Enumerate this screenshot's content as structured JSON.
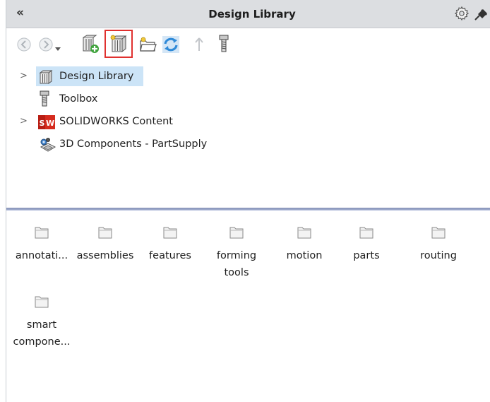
{
  "titlebar": {
    "collapse_glyph": "«",
    "title": "Design Library",
    "icons": [
      "gear-icon",
      "pin-icon"
    ]
  },
  "toolbar": {
    "buttons": [
      {
        "name": "back-button",
        "icon": "back-arrow-icon"
      },
      {
        "name": "forward-button",
        "icon": "forward-arrow-icon"
      },
      {
        "name": "history-dropdown",
        "icon": "chevron-down-icon"
      },
      {
        "name": "add-to-library-button",
        "icon": "add-to-library-icon"
      },
      {
        "name": "add-file-location-button",
        "icon": "library-books-icon",
        "highlighted": true
      },
      {
        "name": "create-new-folder-button",
        "icon": "new-folder-icon"
      },
      {
        "name": "refresh-button",
        "icon": "refresh-icon"
      },
      {
        "name": "up-one-level-button",
        "icon": "up-arrow-icon"
      },
      {
        "name": "toolbox-button",
        "icon": "toolbox-bolt-icon"
      }
    ]
  },
  "tree": {
    "items": [
      {
        "label": "Design Library",
        "expandable": true,
        "selected": true,
        "icon": "design-library-icon"
      },
      {
        "label": "Toolbox",
        "expandable": false,
        "selected": false,
        "icon": "toolbox-bolt-icon"
      },
      {
        "label": "SOLIDWORKS Content",
        "expandable": true,
        "selected": false,
        "icon": "solidworks-logo-icon"
      },
      {
        "label": "3D Components - PartSupply",
        "expandable": false,
        "selected": false,
        "icon": "partsupply-icon"
      }
    ]
  },
  "folders": {
    "row1": [
      "annotati...",
      "assemblies",
      "features",
      "forming",
      "motion",
      "parts",
      "routing"
    ],
    "forming_line2": "tools",
    "row2_line1": "smart",
    "row2_line2": "compone..."
  },
  "colors": {
    "titlebar_bg": "#dcdee1",
    "selection_bg": "#cce4f7",
    "splitter": "#9aa6c8",
    "highlight": "#e0312f",
    "refresh_blue": "#2f8ad8"
  }
}
